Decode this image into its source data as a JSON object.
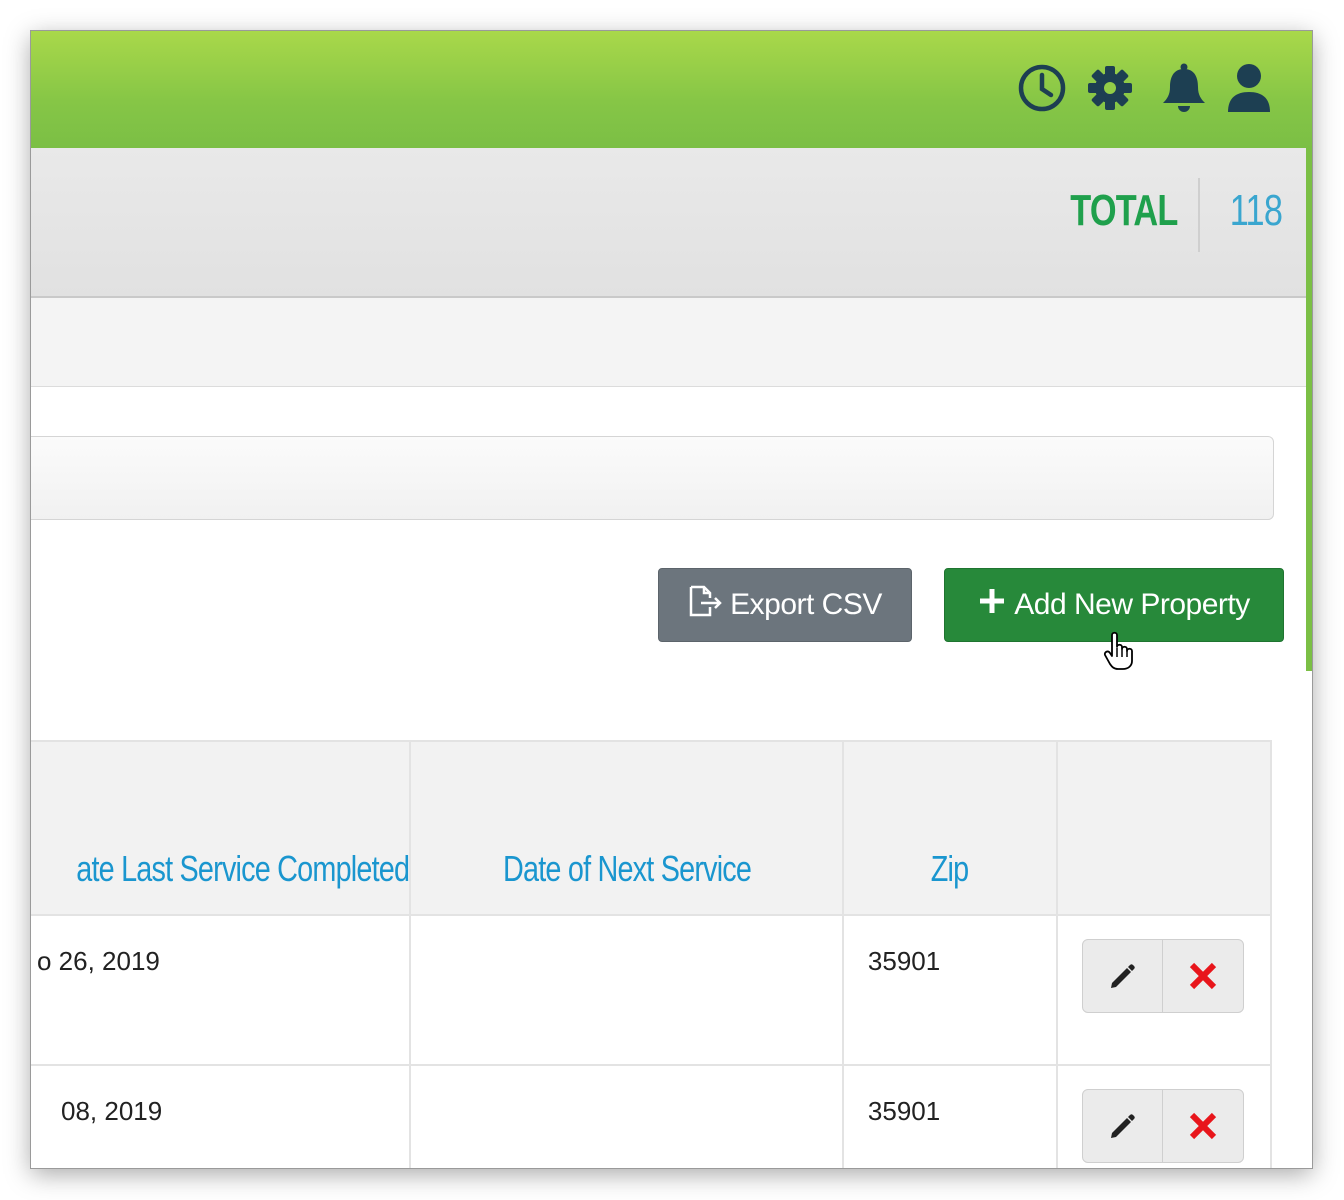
{
  "header": {
    "icons": [
      "clock-icon",
      "gear-icon",
      "bell-icon",
      "user-icon"
    ],
    "color": "#86c646"
  },
  "stats": {
    "label": "TOTAL",
    "value": "118"
  },
  "buttons": {
    "export_label": "Export CSV",
    "add_label": "Add New Property"
  },
  "table": {
    "columns": [
      "ate Last Service Completed",
      "Date of Next Service",
      "Zip",
      ""
    ],
    "rows": [
      {
        "last_service": "o 26, 2019",
        "next_service": "",
        "zip": "35901"
      },
      {
        "last_service": "08, 2019",
        "next_service": "",
        "zip": "35901"
      }
    ]
  },
  "colors": {
    "total_label": "#1fa04c",
    "total_value": "#3aa6cf",
    "header_link": "#1a96cf",
    "add_button": "#27893a",
    "export_button": "#6c757d",
    "delete": "#e8151b"
  }
}
